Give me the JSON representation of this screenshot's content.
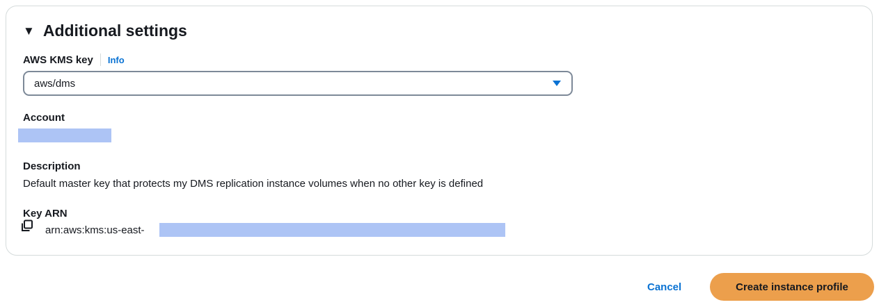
{
  "section": {
    "title": "Additional settings",
    "caret_icon": "caret-down-icon"
  },
  "kms": {
    "label": "AWS KMS key",
    "info_link": "Info",
    "selected": "aws/dms"
  },
  "details": {
    "account_label": "Account",
    "description_label": "Description",
    "description_value": "Default master key that protects my DMS replication instance volumes when no other key is defined",
    "key_arn_label": "Key ARN",
    "key_arn_prefix": "arn:aws:kms:us-east-"
  },
  "footer": {
    "cancel_label": "Cancel",
    "create_label": "Create instance profile"
  },
  "colors": {
    "accent": "#0972d3",
    "primary_button": "#ec9f4c",
    "redaction": "#adc4f5"
  }
}
